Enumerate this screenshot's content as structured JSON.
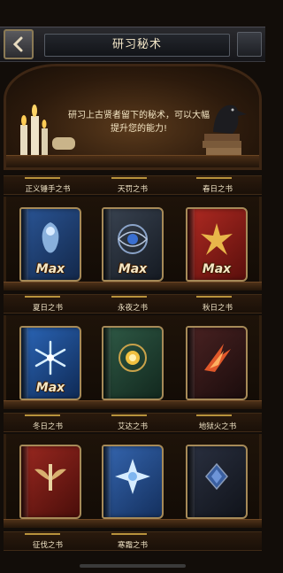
{
  "header": {
    "title": "研习秘术"
  },
  "banner": {
    "text": "研习上古贤者留下的秘术，可以大幅提升您的能力!"
  },
  "max_label": "Max",
  "rows": [
    {
      "books": [
        {
          "name": "正义锤手之书",
          "max": true,
          "color": "#1f3f6e",
          "icon": "angel-icon"
        },
        {
          "name": "天罚之书",
          "max": true,
          "color": "#26303c",
          "icon": "eye-sigil-icon"
        },
        {
          "name": "春日之书",
          "max": true,
          "color": "#8c1d18",
          "icon": "leaf-icon"
        }
      ]
    },
    {
      "books": [
        {
          "name": "夏日之书",
          "max": true,
          "color": "#1c4a86",
          "icon": "snowflake-icon"
        },
        {
          "name": "永夜之书",
          "max": false,
          "color": "#244a3a",
          "icon": "sun-icon"
        },
        {
          "name": "秋日之书",
          "max": false,
          "color": "#3a1a1a",
          "icon": "fire-claw-icon"
        }
      ]
    },
    {
      "books": [
        {
          "name": "冬日之书",
          "max": false,
          "color": "#7a1c18",
          "icon": "winged-sword-icon"
        },
        {
          "name": "艾达之书",
          "max": false,
          "color": "#2a4a88",
          "icon": "star-sigil-icon"
        },
        {
          "name": "地狱火之书",
          "max": false,
          "color": "#1c2230",
          "icon": "gem-icon"
        }
      ]
    },
    {
      "books": [
        {
          "name": "征伐之书"
        },
        {
          "name": "寒霜之书"
        }
      ]
    }
  ]
}
